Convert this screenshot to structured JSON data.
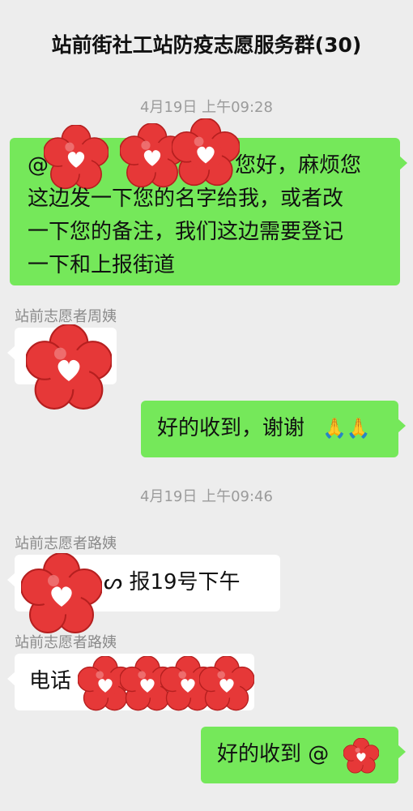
{
  "header": {
    "title": "站前街社工站防疫志愿服务群(30)"
  },
  "messages": {
    "ts1": "4月19日  上午09:28",
    "m1": {
      "at": "@",
      "line1": "您好，麻烦您",
      "line2": "这边发一下您的名字给我，或者改",
      "line3": "一下您的备注，我们这边需要登记",
      "line4": "一下和上报街道"
    },
    "sender2": "站前志愿者周姨",
    "m3": {
      "text": "好的收到，谢谢",
      "emoji": "🙏🙏"
    },
    "ts2": "4月19日  上午09:46",
    "sender4": "站前志愿者路姨",
    "m4": {
      "text": "ᔕ 报19号下午"
    },
    "sender5": "站前志愿者路姨",
    "m5": {
      "text": "电话"
    },
    "m6": {
      "text": "好的收到  @"
    }
  },
  "colors": {
    "green_bubble": "#75e85a",
    "white_bubble": "#ffffff",
    "sticker_red": "#e63838",
    "background": "#ededed"
  },
  "icons": {
    "privacy_sticker": "red-flower-heart-sticker"
  }
}
